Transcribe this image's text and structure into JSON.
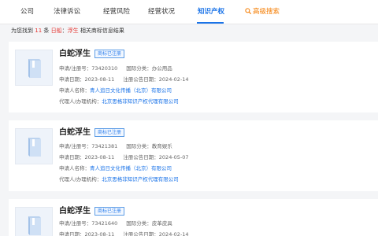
{
  "tabs": [
    {
      "label": "公司"
    },
    {
      "label": "法律诉讼"
    },
    {
      "label": "经营风险"
    },
    {
      "label": "经营状况"
    },
    {
      "label": "知识产权",
      "active": true
    },
    {
      "label": "高级搜索"
    }
  ],
  "summary": {
    "prefix": "为您找到",
    "count": "11",
    "mid": "条",
    "keyword_label": "日船",
    "keyword_sep": "：",
    "keyword": "浮生",
    "suffix": "相关商标信息结果"
  },
  "labels": {
    "reg_no": "申请/注册号：",
    "intl_class": "国际分类：",
    "apply_date": "申请日期：",
    "notice_date": "注册公告日期：",
    "applicant": "申请人名称：",
    "agent": "代理人/办理机构："
  },
  "results": [
    {
      "name": "白蛇浮生",
      "status": "商标已注册",
      "reg_no": "73420310",
      "intl_class": "办公用品",
      "apply_date": "2023-08-11",
      "notice_date": "2024-02-14",
      "applicant": "青人追日文化传播（北京）有限公司",
      "agent": "北京思格非知识产权代理有限公司"
    },
    {
      "name": "白蛇浮生",
      "status": "商标已注册",
      "reg_no": "73421381",
      "intl_class": "教育娱乐",
      "apply_date": "2023-08-11",
      "notice_date": "2024-05-07",
      "applicant": "青人追日文化传播（北京）有限公司",
      "agent": "北京思格非知识产权代理有限公司"
    },
    {
      "name": "白蛇浮生",
      "status": "商标已注册",
      "reg_no": "73421640",
      "intl_class": "皮革皮具",
      "apply_date": "2023-08-11",
      "notice_date": "2024-02-14",
      "applicant": "",
      "agent": ""
    }
  ],
  "colors": {
    "accent": "#1a73e8",
    "highlight": "#e53935",
    "search": "#f57c00",
    "badge_border": "#5c9ce6",
    "page_bg": "#f4f5f7"
  },
  "icons": {
    "search": "magnifier-icon",
    "trademark": "trademark-book-icon"
  }
}
